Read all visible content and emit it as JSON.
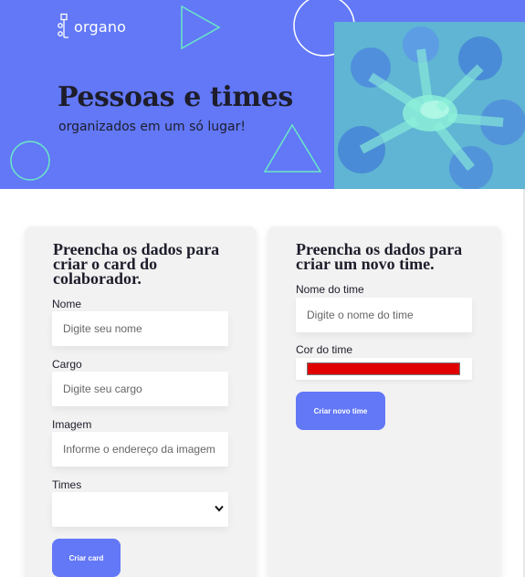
{
  "brand": {
    "logo_text": "organo"
  },
  "banner": {
    "title": "Pessoas e times",
    "subtitle": "organizados em um só lugar!",
    "colors": {
      "background": "#6278f7",
      "photo_tint": "#6be8c7",
      "outline": "#6be8c7"
    }
  },
  "collaborator_form": {
    "title_line1": "Preencha os dados para",
    "title_line2": "criar o card do",
    "title_line3": "colaborador.",
    "name": {
      "label": "Nome",
      "placeholder": "Digite seu nome",
      "value": ""
    },
    "role": {
      "label": "Cargo",
      "placeholder": "Digite seu cargo",
      "value": ""
    },
    "image": {
      "label": "Imagem",
      "placeholder": "Informe o endereço da imagem",
      "value": ""
    },
    "teams": {
      "label": "Times",
      "selected": ""
    },
    "submit_label": "Criar card"
  },
  "team_form": {
    "title_line1": "Preencha os dados para",
    "title_line2": "criar um novo time.",
    "team_name": {
      "label": "Nome do time",
      "placeholder": "Digite o nome do time",
      "value": ""
    },
    "team_color": {
      "label": "Cor do time",
      "value": "#e00000"
    },
    "submit_label": "Criar novo time"
  },
  "icons": {
    "logo": "organo-logo-icon",
    "select_arrow": "chevron-down-icon"
  }
}
